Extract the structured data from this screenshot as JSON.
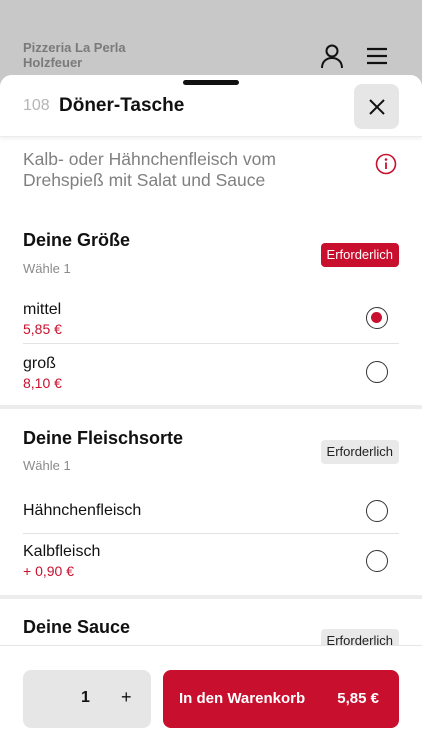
{
  "app": {
    "brand_line1": "Pizzeria La Perla",
    "brand_line2": "Holzfeuer"
  },
  "header_icons": [
    "user-icon",
    "menu-icon"
  ],
  "item": {
    "number": "108",
    "title": "Döner-Tasche",
    "description": "Kalb- oder Hähnchenfleisch vom Drehspieß mit Salat und Sauce"
  },
  "sections": [
    {
      "title": "Deine Größe",
      "subtitle": "Wähle 1",
      "badge": "Erforderlich",
      "badge_style": "red",
      "options": [
        {
          "name": "mittel",
          "price": "5,85 €",
          "selected": true
        },
        {
          "name": "groß",
          "price": "8,10 €",
          "selected": false
        }
      ]
    },
    {
      "title": "Deine Fleischsorte",
      "subtitle": "Wähle 1",
      "badge": "Erforderlich",
      "badge_style": "grey",
      "options": [
        {
          "name": "Hähnchenfleisch",
          "price": "",
          "selected": false
        },
        {
          "name": "Kalbfleisch",
          "price": "+ 0,90 €",
          "selected": false
        }
      ]
    },
    {
      "title": "Deine Sauce",
      "badge": "Erforderlich",
      "badge_style": "grey"
    }
  ],
  "footer": {
    "quantity": "1",
    "plus": "+",
    "cart_label": "In den Warenkorb",
    "cart_price": "5,85 €"
  },
  "colors": {
    "accent": "#c8102e",
    "badge_grey": "#e9e9e9"
  }
}
